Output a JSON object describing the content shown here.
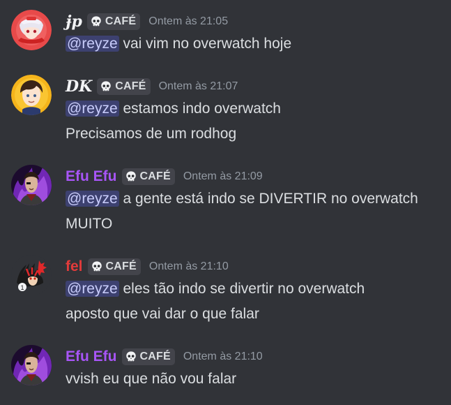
{
  "colors": {
    "background": "#313338",
    "text": "#dbdee1",
    "timestamp": "#949ba4",
    "tag_bg": "#43444b",
    "mention_bg": "rgba(88,101,242,0.3)",
    "mention_text": "#c9cdfb",
    "user_white": "#f2f3f5",
    "user_purple": "#a855f7",
    "user_red": "#e23b3b"
  },
  "tag_icon": "skull-icon",
  "messages": [
    {
      "username": "ɉp",
      "tag": "CAFÉ",
      "timestamp": "Ontem às 21:05",
      "avatar": "anime-girl-red-avatar",
      "lines": [
        {
          "mention": "@reyze",
          "text": " vai vim no overwatch hoje"
        }
      ]
    },
    {
      "username": "DK",
      "tag": "CAFÉ",
      "timestamp": "Ontem às 21:07",
      "avatar": "anime-boy-yellow-avatar",
      "lines": [
        {
          "mention": "@reyze",
          "text": " estamos indo overwatch"
        },
        {
          "mention": "",
          "text": "Precisamos de um rodhog"
        }
      ]
    },
    {
      "username": "Efu Efu",
      "tag": "CAFÉ",
      "timestamp": "Ontem às 21:09",
      "avatar": "purple-fire-avatar",
      "lines": [
        {
          "mention": "@reyze",
          "text": " a gente está indo se DIVERTIR no overwatch"
        },
        {
          "mention": "",
          "text": "MUITO"
        }
      ]
    },
    {
      "username": "fel",
      "tag": "CAFÉ",
      "timestamp": "Ontem às 21:10",
      "avatar": "black-hedgehog-avatar",
      "lines": [
        {
          "mention": "@reyze",
          "text": " eles tão indo se divertir no overwatch"
        },
        {
          "mention": "",
          "text": "aposto que vai dar o que falar"
        }
      ]
    },
    {
      "username": "Efu Efu",
      "tag": "CAFÉ",
      "timestamp": "Ontem às 21:10",
      "avatar": "purple-fire-avatar",
      "lines": [
        {
          "mention": "",
          "text": "vvish eu que não vou falar"
        }
      ]
    }
  ]
}
